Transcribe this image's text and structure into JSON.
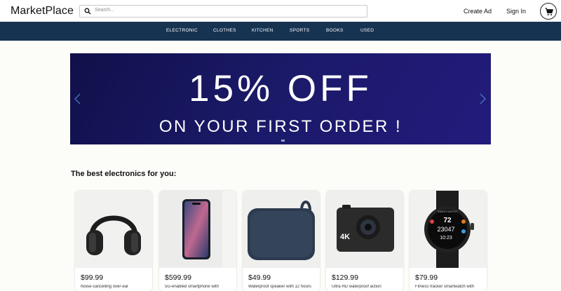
{
  "header": {
    "logo": "MarketPlace",
    "search_placeholder": "Search...",
    "create_ad": "Create Ad",
    "sign_in": "Sign In"
  },
  "categories": [
    "ELECTRONIC",
    "CLOTHES",
    "KITCHEN",
    "SPORTS",
    "BOOKS",
    "USED"
  ],
  "banner": {
    "headline": "15% OFF",
    "subline": "ON YOUR FIRST ORDER !"
  },
  "section_title": "The best electronics for you:",
  "products": [
    {
      "price": "$99.99",
      "desc": "Noise-cancelling over-ear",
      "icon": "headphones-image"
    },
    {
      "price": "$599.99",
      "desc": "5G-enabled smartphone with",
      "icon": "smartphone-image"
    },
    {
      "price": "$49.99",
      "desc": "Waterproof speaker with 12 hours",
      "icon": "speaker-image"
    },
    {
      "price": "$129.99",
      "desc": "Ultra HD waterproof action",
      "icon": "action-camera-image",
      "badge": "4K"
    },
    {
      "price": "$79.99",
      "desc": "Fitness tracker smartwatch with",
      "icon": "smartwatch-image",
      "watch_label": "SMARTWATCH",
      "watch_bpm": "72",
      "watch_steps": "23047",
      "watch_time": "10:23"
    }
  ]
}
